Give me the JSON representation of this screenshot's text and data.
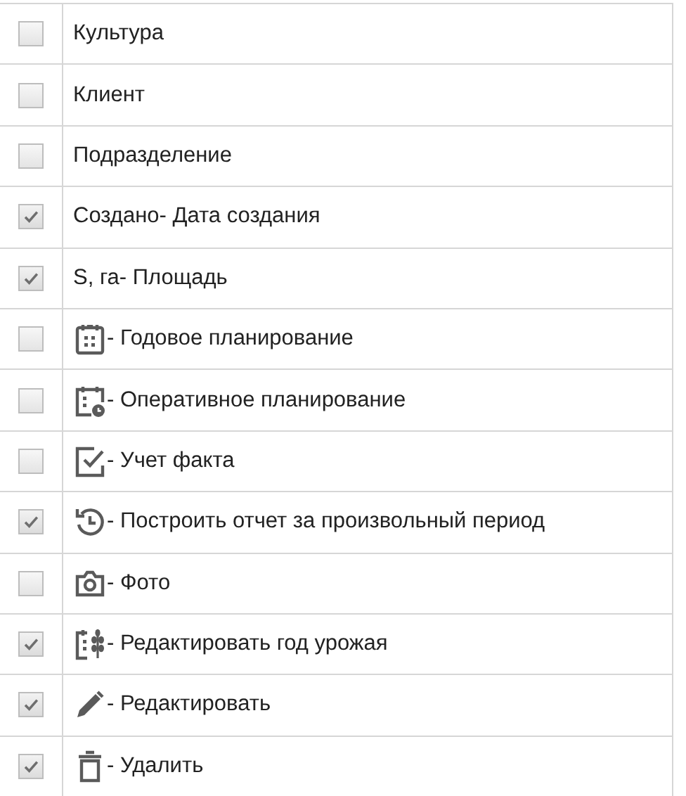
{
  "rows": [
    {
      "kind": "text",
      "label": "Культура",
      "checked": false
    },
    {
      "kind": "text",
      "label": "Клиент",
      "checked": false
    },
    {
      "kind": "text",
      "label": "Подразделение",
      "checked": false
    },
    {
      "kind": "text",
      "label": "Создано- Дата создания",
      "checked": true
    },
    {
      "kind": "text",
      "label": "S, га- Площадь",
      "checked": true
    },
    {
      "kind": "calendar",
      "label": "- Годовое планирование",
      "checked": false
    },
    {
      "kind": "calendar-clock",
      "label": "- Оперативное планирование",
      "checked": false
    },
    {
      "kind": "check-square",
      "label": "- Учет факта",
      "checked": false
    },
    {
      "kind": "history",
      "label": "- Построить отчет за произвольный период",
      "checked": true
    },
    {
      "kind": "camera",
      "label": "- Фото",
      "checked": false
    },
    {
      "kind": "calendar-wheat",
      "label": "- Редактировать год урожая",
      "checked": true
    },
    {
      "kind": "pencil",
      "label": "- Редактировать",
      "checked": true
    },
    {
      "kind": "trash",
      "label": "- Удалить",
      "checked": true
    }
  ]
}
